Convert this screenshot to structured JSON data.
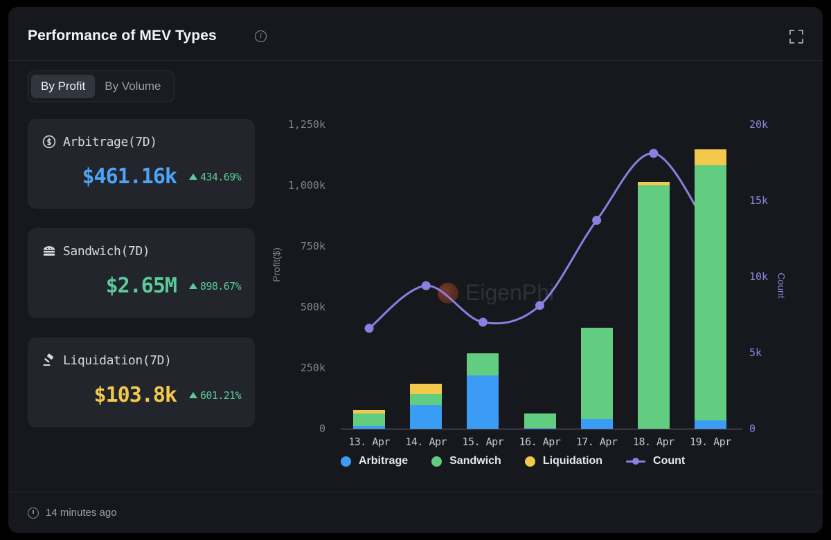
{
  "header": {
    "title": "Performance of MEV Types",
    "info_icon": "info-icon",
    "expand_icon": "fullscreen-icon"
  },
  "tabs": [
    {
      "label": "By Profit",
      "active": true
    },
    {
      "label": "By Volume",
      "active": false
    }
  ],
  "stats": [
    {
      "icon": "coin-dollar-icon",
      "name": "Arbitrage(7D)",
      "value": "$461.16k",
      "value_color": "#4da3f5",
      "change": "434.69%",
      "change_dir": "up"
    },
    {
      "icon": "sandwich-icon",
      "name": "Sandwich(7D)",
      "value": "$2.65M",
      "value_color": "#5ccb9a",
      "change": "898.67%",
      "change_dir": "up"
    },
    {
      "icon": "gavel-icon",
      "name": "Liquidation(7D)",
      "value": "$103.8k",
      "value_color": "#f2c94c",
      "change": "601.21%",
      "change_dir": "up"
    }
  ],
  "chart_data": {
    "type": "bar",
    "title": "Performance of MEV Types",
    "xlabel": "",
    "ylabel": "Profit($)",
    "y2label": "Count",
    "categories": [
      "13. Apr",
      "14. Apr",
      "15. Apr",
      "16. Apr",
      "17. Apr",
      "18. Apr",
      "19. Apr"
    ],
    "ylim": [
      0,
      1250000
    ],
    "yticks": [
      "0",
      "250k",
      "500k",
      "750k",
      "1,000k",
      "1,250k"
    ],
    "ytick_values": [
      0,
      250000,
      500000,
      750000,
      1000000,
      1250000
    ],
    "y2lim": [
      0,
      20000
    ],
    "y2ticks": [
      "0",
      "5k",
      "10k",
      "15k",
      "20k"
    ],
    "y2tick_values": [
      0,
      5000,
      10000,
      15000,
      20000
    ],
    "grid": false,
    "legend_position": "bottom",
    "stacked": true,
    "series": [
      {
        "name": "Arbitrage",
        "type": "bar",
        "color": "#3b9cf5",
        "axis": "left",
        "values": [
          12000,
          96000,
          218000,
          3000,
          40000,
          0,
          33000
        ]
      },
      {
        "name": "Sandwich",
        "type": "bar",
        "color": "#62cc80",
        "axis": "left",
        "values": [
          50000,
          46000,
          93000,
          60000,
          375000,
          1000000,
          1050000
        ]
      },
      {
        "name": "Liquidation",
        "type": "bar",
        "color": "#f2c94c",
        "axis": "left",
        "values": [
          16000,
          43000,
          0,
          0,
          0,
          15000,
          65000
        ]
      },
      {
        "name": "Count",
        "type": "line",
        "color": "#8b7fe0",
        "axis": "right",
        "values": [
          6600,
          9400,
          7000,
          8100,
          13700,
          18100,
          12900
        ]
      }
    ],
    "watermark": "EigenPhi"
  },
  "footer": {
    "clock_icon": "clock-icon",
    "updated": "14 minutes ago"
  }
}
